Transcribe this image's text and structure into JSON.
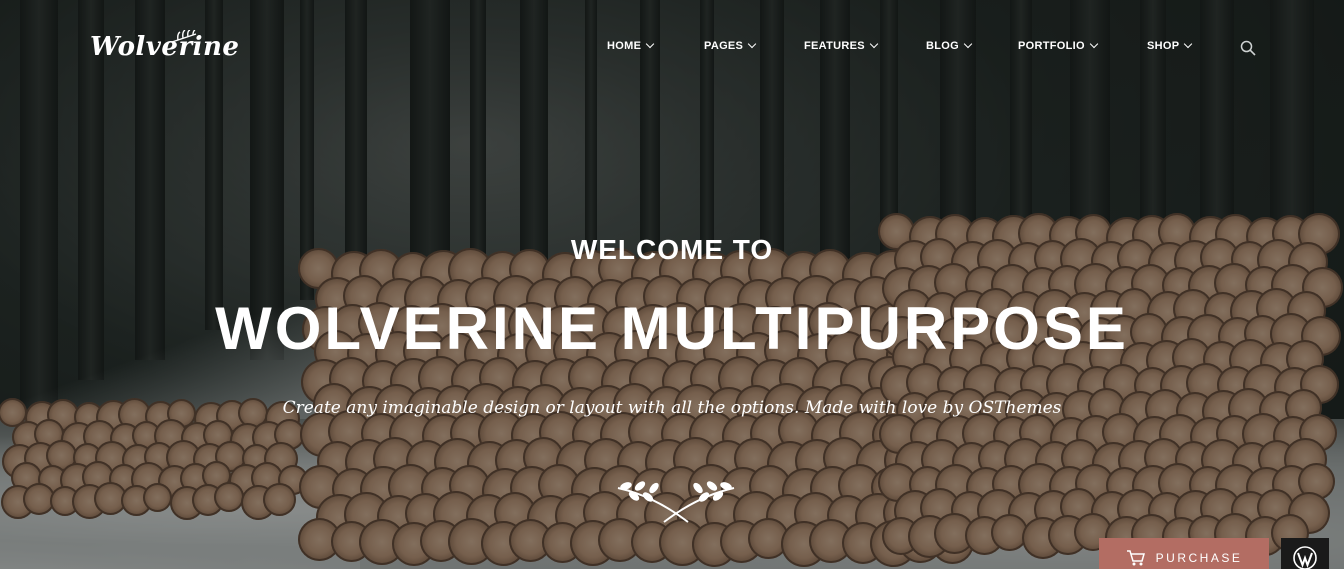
{
  "header": {
    "logo_text": "Wolverine",
    "nav": [
      {
        "label": "HOME"
      },
      {
        "label": "PAGES"
      },
      {
        "label": "FEATURES"
      },
      {
        "label": "BLOG"
      },
      {
        "label": "PORTFOLIO"
      },
      {
        "label": "SHOP"
      }
    ],
    "search_icon": "search-icon"
  },
  "hero": {
    "welcome": "WELCOME TO",
    "title": "WOLVERINE MULTIPURPOSE",
    "tagline": "Create any imaginable design or layout with all the options. Made with love by OSThemes",
    "ornament_icon": "crossed-branches-icon"
  },
  "actions": {
    "purchase_label": "PURCHASE",
    "purchase_icon": "cart-icon",
    "purchase_color": "#b36d63",
    "wordpress_icon": "wordpress-icon"
  }
}
